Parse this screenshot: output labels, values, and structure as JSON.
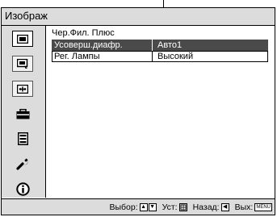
{
  "header": {
    "title": "Изображ"
  },
  "sidebar": {
    "items": [
      {
        "icon": "picture-icon",
        "active": true
      },
      {
        "icon": "advanced-picture-icon",
        "active": false
      },
      {
        "icon": "screen-icon",
        "active": false
      },
      {
        "icon": "setup-icon",
        "active": false
      },
      {
        "icon": "function-icon",
        "active": false
      },
      {
        "icon": "installation-icon",
        "active": false
      },
      {
        "icon": "information-icon",
        "active": false
      }
    ]
  },
  "content": {
    "section_title": "Чер.Фил. Плюс",
    "rows": [
      {
        "label": "Усоверш.диафр.",
        "value": "Авто1",
        "selected": true
      },
      {
        "label": "Рег. Лампы",
        "value": "Высокий",
        "selected": false
      }
    ]
  },
  "footer": {
    "select_label": "Выбор:",
    "set_label": "Уст:",
    "back_label": "Назад:",
    "exit_label": "Вых:",
    "menu_key": "MENU"
  },
  "colors": {
    "panel_gray": "#dcdcdc",
    "highlight": "#4a4a4a",
    "border": "#000000"
  }
}
